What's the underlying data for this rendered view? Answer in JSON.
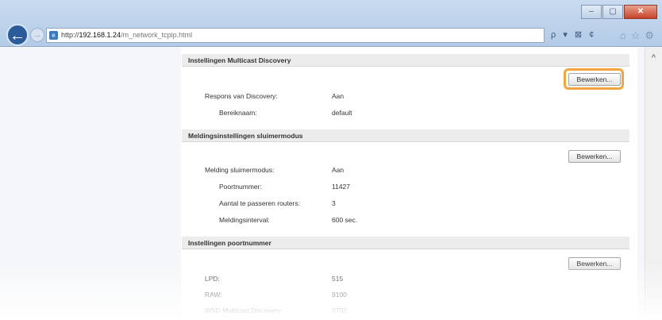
{
  "browser": {
    "window_buttons": [
      "–",
      "▢",
      "✕"
    ],
    "back_glyph": "←",
    "forward_glyph": "→",
    "address_prefix": "http://",
    "address_host": "192.168.1.24",
    "address_path": "/m_network_tcpip.html",
    "address_tools": "ρ ▾ ⊠ ¢",
    "nav_icons": [
      "⌂",
      "☆",
      "⚙"
    ]
  },
  "sections": [
    {
      "title": "Instellingen Multicast Discovery",
      "edit_label": "Bewerken...",
      "rows": [
        {
          "label": "Respons van Discovery:",
          "value": "Aan"
        },
        {
          "label": "Bereiknaam:",
          "value": "default"
        }
      ]
    },
    {
      "title": "Meldingsinstellingen sluimermodus",
      "edit_label": "Bewerken...",
      "rows": [
        {
          "label": "Melding sluimermodus:",
          "value": "Aan"
        },
        {
          "label": "Poortnummer:",
          "value": "11427"
        },
        {
          "label": "Aantal te passeren routers:",
          "value": "3"
        },
        {
          "label": "Meldingsinterval:",
          "value": "600 sec."
        }
      ]
    },
    {
      "title": "Instellingen poortnummer",
      "edit_label": "Bewerken...",
      "rows": [
        {
          "label": "LPD:",
          "value": "515"
        },
        {
          "label": "RAW:",
          "value": "9100"
        },
        {
          "label": "WSD Multicast Discovery:",
          "value": "3702"
        }
      ]
    }
  ],
  "scrollbar": {
    "up_glyph": "^"
  },
  "colors": {
    "highlight": "#f2a53f",
    "back_button": "#2b5c99"
  }
}
